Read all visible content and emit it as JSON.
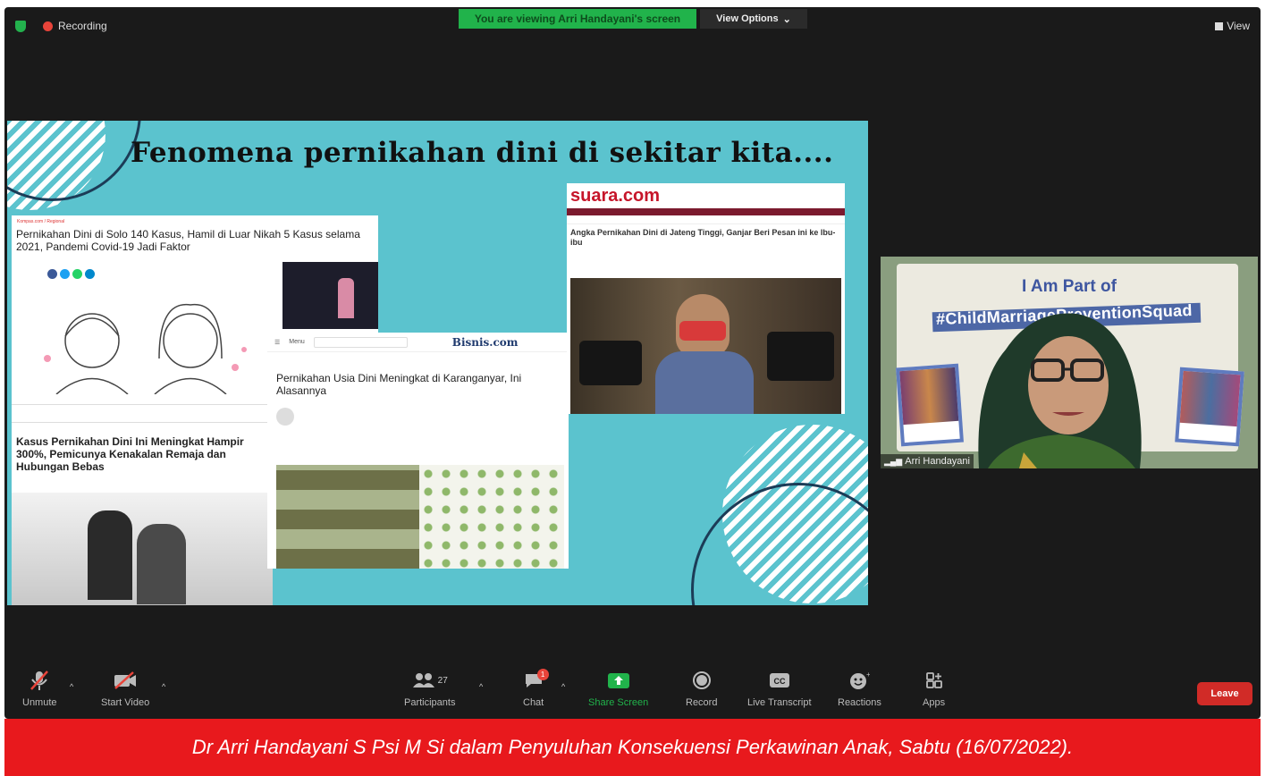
{
  "topbar": {
    "recording_label": "Recording",
    "viewing_banner": "You are viewing Arri Handayani's screen",
    "view_options_label": "View Options",
    "view_label": "View"
  },
  "slide": {
    "title": "Fenomena pernikahan dini di sekitar kita....",
    "news_a1": {
      "breadcrumb": "Kompas.com / Regional",
      "headline": "Pernikahan Dini di Solo 140 Kasus, Hamil di Luar Nikah 5 Kasus selama 2021, Pandemi Covid-19 Jadi Faktor"
    },
    "news_a2": {
      "headline": "Kasus Pernikahan Dini Ini Meningkat Hampir 300%, Pemicunya Kenakalan Remaja dan Hubungan Bebas"
    },
    "news_b": {
      "site": "Bisnis.com",
      "menu": "Menu",
      "headline": "Pernikahan Usia Dini Meningkat di Karanganyar, Ini Alasannya"
    },
    "news_c": {
      "site": "suara.com",
      "headline": "Angka Pernikahan Dini di Jateng Tinggi, Ganjar Beri Pesan ini ke Ibu-ibu"
    }
  },
  "video_tile": {
    "poster_line1": "I Am Part of",
    "poster_hashtag": "#ChildMarriagePreventionSquad",
    "participant_name": "Arri Handayani"
  },
  "toolbar": {
    "unmute": "Unmute",
    "start_video": "Start Video",
    "participants": "Participants",
    "participants_count": "27",
    "chat": "Chat",
    "chat_badge": "1",
    "share_screen": "Share Screen",
    "record": "Record",
    "live_transcript": "Live Transcript",
    "reactions": "Reactions",
    "apps": "Apps",
    "leave": "Leave"
  },
  "caption": "Dr Arri Handayani S Psi M Si dalam Penyuluhan Konsekuensi Perkawinan Anak, Sabtu (16/07/2022).",
  "colors": {
    "share_green": "#21b34b",
    "leave_red": "#d12b27",
    "caption_red": "#e8191d",
    "slide_teal": "#5bc3ce"
  }
}
